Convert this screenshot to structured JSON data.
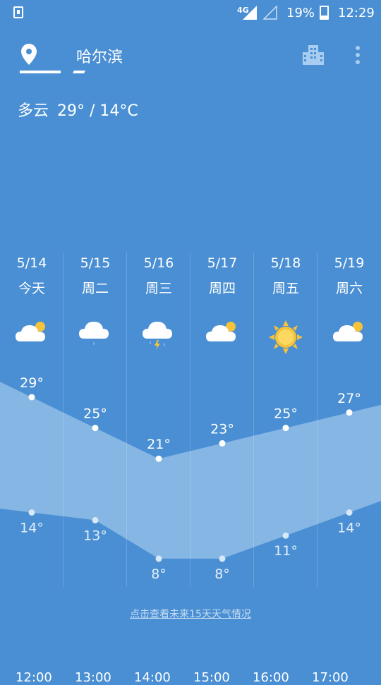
{
  "status_bar": {
    "network": "4G",
    "battery": "19%",
    "time": "12:29"
  },
  "header": {
    "city": "哈尔滨"
  },
  "today": {
    "condition": "多云",
    "temp_range": "29° / 14°C"
  },
  "days": [
    {
      "date": "5/14",
      "label": "今天",
      "icon": "partly-cloudy-icon",
      "high": "29°",
      "low": "14°"
    },
    {
      "date": "5/15",
      "label": "周二",
      "icon": "light-rain-icon",
      "high": "25°",
      "low": "13°"
    },
    {
      "date": "5/16",
      "label": "周三",
      "icon": "thunder-shower-icon",
      "high": "21°",
      "low": "8°"
    },
    {
      "date": "5/17",
      "label": "周四",
      "icon": "partly-cloudy-icon",
      "high": "23°",
      "low": "8°"
    },
    {
      "date": "5/18",
      "label": "周五",
      "icon": "sunny-icon",
      "high": "25°",
      "low": "11°"
    },
    {
      "date": "5/19",
      "label": "周六",
      "icon": "partly-cloudy-icon",
      "high": "27°",
      "low": "14°"
    }
  ],
  "chart_data": {
    "type": "area",
    "categories": [
      "5/14",
      "5/15",
      "5/16",
      "5/17",
      "5/18",
      "5/19"
    ],
    "series": [
      {
        "name": "",
        "values": [
          29,
          25,
          21,
          23,
          25,
          27
        ]
      },
      {
        "name": "",
        "values": [
          14,
          13,
          8,
          8,
          11,
          14
        ]
      }
    ]
  },
  "more_link": "点击查看未来15天天气情况",
  "hourly_partial": [
    "12:00",
    "13:00",
    "14:00",
    "15:00",
    "16:00",
    "17:00"
  ],
  "colors": {
    "background": "#4a8fd3",
    "band": "#8fbde6",
    "sun": "#f5c33b"
  }
}
